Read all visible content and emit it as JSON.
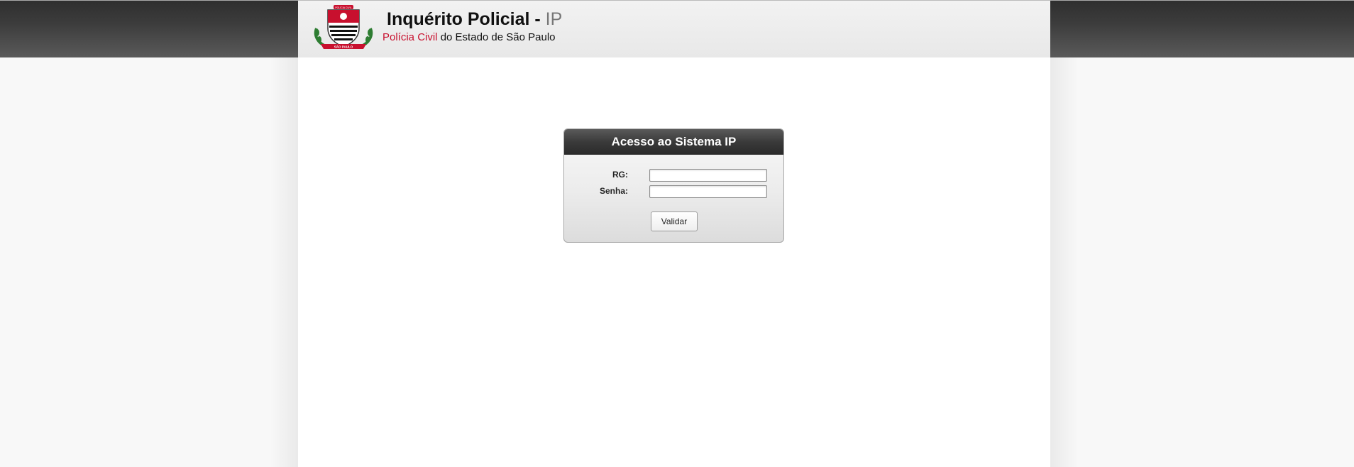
{
  "header": {
    "title_main": "Inquérito Policial - ",
    "title_suffix": "IP",
    "subtitle_red": "Polícia Civil",
    "subtitle_rest": " do Estado de São Paulo",
    "emblem_top_text": "POLÍCIA CIVIL",
    "emblem_bottom_text": "SÃO PAULO"
  },
  "login": {
    "title": "Acesso ao Sistema IP",
    "rg_label": "RG:",
    "rg_value": "",
    "password_label": "Senha:",
    "password_value": "",
    "submit_label": "Validar"
  },
  "colors": {
    "accent_red": "#c8102e",
    "header_dark": "#3a3a3a"
  }
}
